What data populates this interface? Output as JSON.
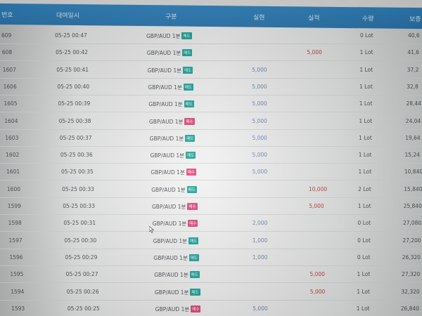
{
  "header": {
    "no": "번호",
    "time": "대여일시",
    "type": "구분",
    "settle": "실현",
    "realized": "실적",
    "qty": "수량",
    "holding": "보증"
  },
  "colors": {
    "header_bg": "#2f86c4",
    "sell_badge": "#1aa39a",
    "buy_badge": "#e0457a",
    "realized_text": "#c43a3a"
  },
  "rows": [
    {
      "no": "609",
      "time": "05-25 00:47",
      "type": "GBP/AUD 1분",
      "badge": "매도",
      "badge_kind": "sell",
      "settle": "",
      "realized": "",
      "qty": "0 Lot",
      "holding": "40,6"
    },
    {
      "no": "608",
      "time": "05-25 00:42",
      "type": "GBP/AUD 1분",
      "badge": "매도",
      "badge_kind": "sell",
      "settle": "",
      "realized": "5,000",
      "qty": "1 Lot",
      "holding": "41,6"
    },
    {
      "no": "1607",
      "time": "05-25 00:41",
      "type": "GBP/AUD 1분",
      "badge": "매도",
      "badge_kind": "sell",
      "settle": "5,000",
      "realized": "",
      "qty": "1 Lot",
      "holding": "37,2"
    },
    {
      "no": "1606",
      "time": "05-25 00:40",
      "type": "GBP/AUD 1분",
      "badge": "매도",
      "badge_kind": "sell",
      "settle": "5,000",
      "realized": "",
      "qty": "1 Lot",
      "holding": "32,8"
    },
    {
      "no": "1605",
      "time": "05-25 00:39",
      "type": "GBP/AUD 1분",
      "badge": "매도",
      "badge_kind": "sell",
      "settle": "5,000",
      "realized": "",
      "qty": "1 Lot",
      "holding": "28,44"
    },
    {
      "no": "1604",
      "time": "05-25 00:38",
      "type": "GBP/AUD 1분",
      "badge": "매수",
      "badge_kind": "buy",
      "settle": "5,000",
      "realized": "",
      "qty": "1 Lot",
      "holding": "24,04"
    },
    {
      "no": "1603",
      "time": "05-25 00:37",
      "type": "GBP/AUD 1분",
      "badge": "매도",
      "badge_kind": "sell",
      "settle": "5,000",
      "realized": "",
      "qty": "1 Lot",
      "holding": "19,64"
    },
    {
      "no": "1602",
      "time": "05-25 00:36",
      "type": "GBP/AUD 1분",
      "badge": "매도",
      "badge_kind": "sell",
      "settle": "5,000",
      "realized": "",
      "qty": "1 Lot",
      "holding": "15,24"
    },
    {
      "no": "1601",
      "time": "05-25 00:35",
      "type": "GBP/AUD 1분",
      "badge": "매수",
      "badge_kind": "buy",
      "settle": "5,000",
      "realized": "",
      "qty": "1 Lot",
      "holding": "10,840"
    },
    {
      "no": "1600",
      "time": "05-25 00:33",
      "type": "GBP/AUD 1분",
      "badge": "매도",
      "badge_kind": "sell",
      "settle": "",
      "realized": "10,000",
      "qty": "2 Lot",
      "holding": "15,840"
    },
    {
      "no": "1599",
      "time": "05-25 00:33",
      "type": "GBP/AUD 1분",
      "badge": "매수",
      "badge_kind": "buy",
      "settle": "",
      "realized": "5,000",
      "qty": "1 Lot",
      "holding": "25,840"
    },
    {
      "no": "1598",
      "time": "05-25 00:31",
      "type": "GBP/AUD 1분",
      "badge": "매수",
      "badge_kind": "buy",
      "settle": "2,000",
      "realized": "",
      "qty": "0 Lot",
      "holding": "27,080"
    },
    {
      "no": "1597",
      "time": "05-25 00:30",
      "type": "GBP/AUD 1분",
      "badge": "매도",
      "badge_kind": "sell",
      "settle": "1,000",
      "realized": "",
      "qty": "0 Lot",
      "holding": "27,200"
    },
    {
      "no": "1596",
      "time": "05-25 00:29",
      "type": "GBP/AUD 1분",
      "badge": "매도",
      "badge_kind": "sell",
      "settle": "1,000",
      "realized": "",
      "qty": "0 Lot",
      "holding": "26,320"
    },
    {
      "no": "1595",
      "time": "05-25 00:27",
      "type": "GBP/AUD 1분",
      "badge": "매도",
      "badge_kind": "sell",
      "settle": "",
      "realized": "5,000",
      "qty": "1 Lot",
      "holding": "27,320"
    },
    {
      "no": "1594",
      "time": "05-25 00:26",
      "type": "GBP/AUD 1분",
      "badge": "매도",
      "badge_kind": "sell",
      "settle": "",
      "realized": "5,000",
      "qty": "1 Lot",
      "holding": "32,320"
    },
    {
      "no": "1593",
      "time": "05-25 00:25",
      "type": "GBP/AUD 1분",
      "badge": "매수",
      "badge_kind": "buy",
      "settle": "5,000",
      "realized": "",
      "qty": "1 Lot",
      "holding": "26,840"
    }
  ]
}
